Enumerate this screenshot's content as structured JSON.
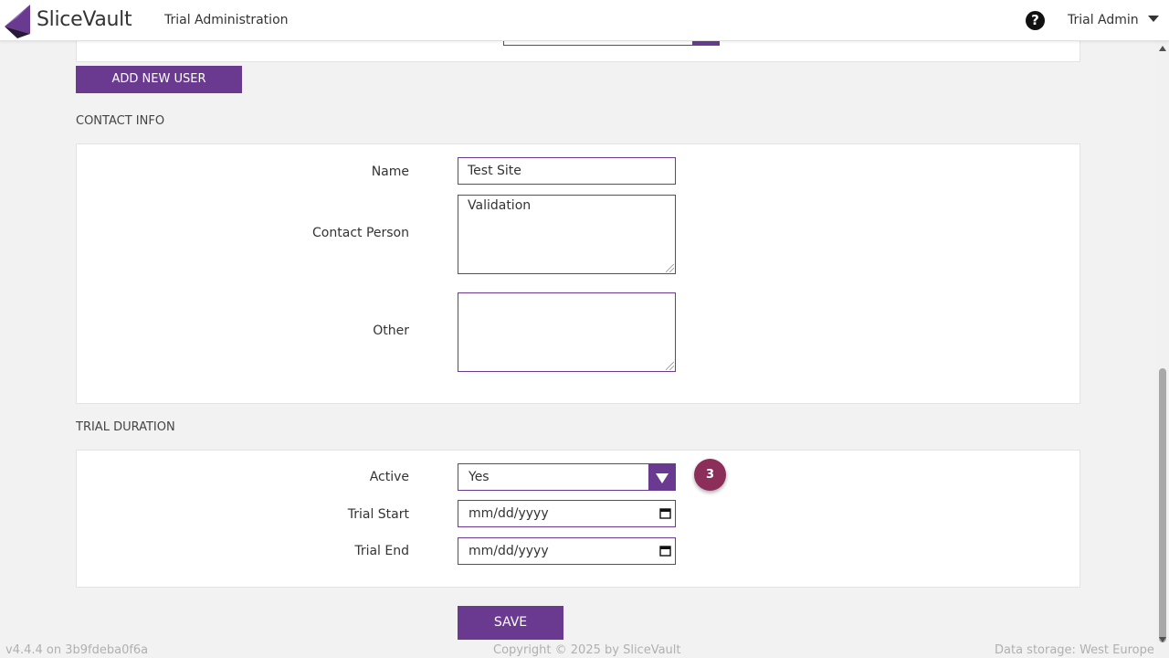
{
  "header": {
    "brand": "SliceVault",
    "title": "Trial Administration",
    "help_icon": "question-circle-icon",
    "help_symbol": "?",
    "user": "Trial Admin"
  },
  "actions": {
    "add_user_label": "ADD NEW USER",
    "save_label": "SAVE"
  },
  "contact_info": {
    "section_title": "CONTACT INFO",
    "name_label": "Name",
    "name_value": "Test Site",
    "contact_person_label": "Contact Person",
    "contact_person_value": "Validation",
    "other_label": "Other",
    "other_value": ""
  },
  "trial_duration": {
    "section_title": "TRIAL DURATION",
    "active_label": "Active",
    "active_value": "Yes",
    "trial_start_label": "Trial Start",
    "trial_start_placeholder": "mm/dd/yyyy",
    "trial_end_label": "Trial End",
    "trial_end_placeholder": "mm/dd/yyyy"
  },
  "step_badge": "3",
  "footer": {
    "version": "v4.4.4 on 3b9fdeba0f6a",
    "copyright": "Copyright © 2025 by SliceVault",
    "storage": "Data storage: West Europe"
  },
  "colors": {
    "accent": "#6a3a90",
    "badge": "#8b2f5a",
    "background": "#f2f2f2"
  }
}
